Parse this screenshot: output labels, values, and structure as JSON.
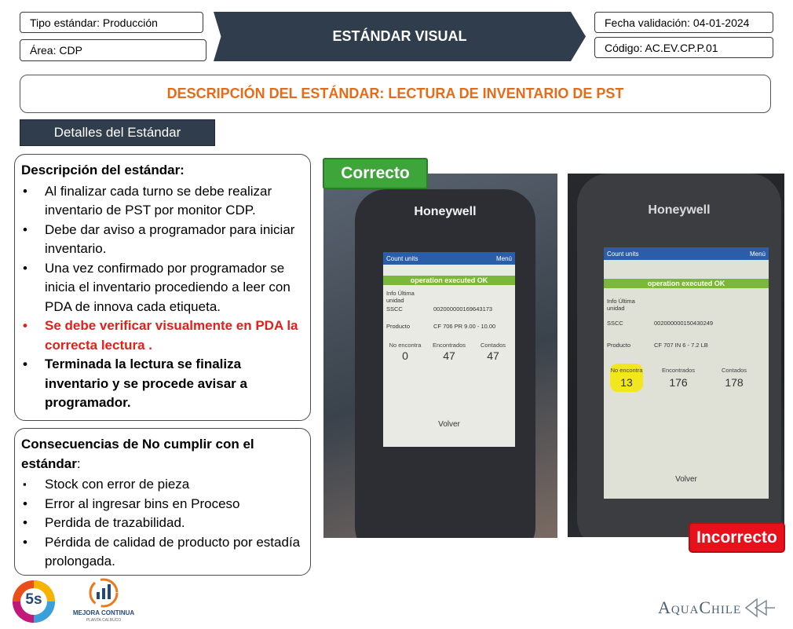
{
  "header": {
    "tipo": "Tipo estándar: Producción",
    "area": "Área: CDP",
    "title": "ESTÁNDAR VISUAL",
    "fecha": "Fecha validación: 04-01-2024",
    "codigo": "Código: AC.EV.CP.P.01"
  },
  "description_title": "DESCRIPCIÓN DEL ESTÁNDAR: LECTURA DE INVENTARIO DE PST",
  "details_tab": "Detalles del Estándar",
  "panel1": {
    "heading": "Descripción del estándar:",
    "bullet_symbol": "•",
    "items": [
      "Al finalizar cada turno se debe realizar inventario de PST por monitor CDP.",
      "Debe dar aviso a programador para iniciar inventario.",
      "Una vez confirmado por programador se inicia el inventario procediendo a leer con PDA de innova cada etiqueta.",
      "Se debe verificar visualmente en PDA la correcta lectura .",
      "Terminada la lectura se finaliza inventario y se procede avisar a programador."
    ]
  },
  "panel2": {
    "heading_a": "Consecuencias de No cumplir con el",
    "heading_b": "estándar",
    "heading_colon": ":",
    "bullet_square": "▪",
    "bullet_symbol": "•",
    "items": [
      "Stock con error de pieza",
      "Error al ingresar bins en Proceso",
      "Perdida de trazabilidad.",
      "Pérdida de calidad de producto por estadía prolongada."
    ]
  },
  "labels": {
    "correct": "Correcto",
    "incorrect": "Incorrecto"
  },
  "colors": {
    "navy": "#2f3d4c",
    "orange": "#e36c1b",
    "red": "#e0201b",
    "green": "#3da53a",
    "incorrect": "#e8101a",
    "highlight": "#f2e61c"
  },
  "pda_left": {
    "brand": "Honeywell",
    "menu_left": "Count units",
    "menu_right": "Menú",
    "status": "operation executed OK",
    "info": "Info Última unidad",
    "sscc_label": "SSCC",
    "sscc_value": "002000000169643173",
    "product_label": "Producto",
    "product_value": "CF 706 PR 9.00 - 10.00",
    "col1": "No encontra",
    "col2": "Encontrados",
    "col3": "Contados",
    "v1": "0",
    "v2": "47",
    "v3": "47",
    "button": "Volver"
  },
  "pda_right": {
    "brand": "Honeywell",
    "menu_left": "Count units",
    "menu_right": "Menú",
    "status": "operation executed OK",
    "info": "Info Última unidad",
    "sscc_label": "SSCC",
    "sscc_value": "002000000150430249",
    "product_label": "Producto",
    "product_value": "CF 707 IN 6 - 7.2 LB",
    "col1": "No encontra",
    "col2": "Encontrados",
    "col3": "Contados",
    "v1": "13",
    "v2": "176",
    "v3": "178",
    "button": "Volver"
  },
  "logos": {
    "five_s": "5s",
    "mejora": "MEJORA CONTINUA",
    "mejora_sub": "PLANTA CALBUCO",
    "aquachile": "AquaChile"
  }
}
